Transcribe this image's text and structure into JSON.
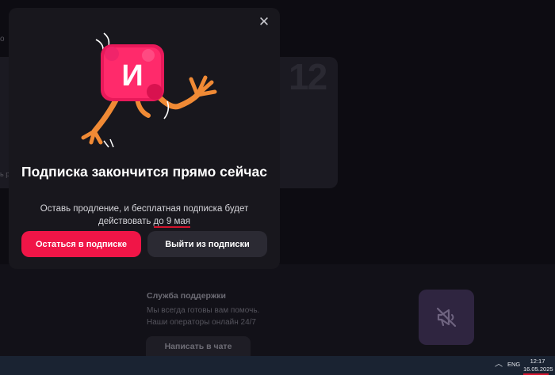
{
  "background": {
    "card_number": "12",
    "edge_letter_top": "o",
    "edge_letter_mid": "ь р",
    "support": {
      "title": "Служба поддержки",
      "line1": "Мы всегда готовы вам помочь.",
      "line2": "Наши операторы онлайн 24/7",
      "chat_button": "Написать в чате"
    },
    "promo_icon": "megaphone-off-icon"
  },
  "modal": {
    "close_icon": "close-icon",
    "mascot_letter": "И",
    "title": "Подписка закончится прямо сейчас",
    "text_line1": "Оставь продление, и бесплатная подписка будет",
    "text_line2_prefix": "действовать",
    "text_line2_date": "до 9 мая",
    "primary_button": "Остаться в подписке",
    "secondary_button": "Выйти из подписки",
    "colors": {
      "accent": "#f01547",
      "panel": "#18171d",
      "secondary": "#2b2a33",
      "underline": "#d3132c"
    }
  },
  "taskbar": {
    "chevron_icon": "chevron-up-icon",
    "language": "ENG",
    "time": "12:17",
    "date": "16.05.2025"
  }
}
